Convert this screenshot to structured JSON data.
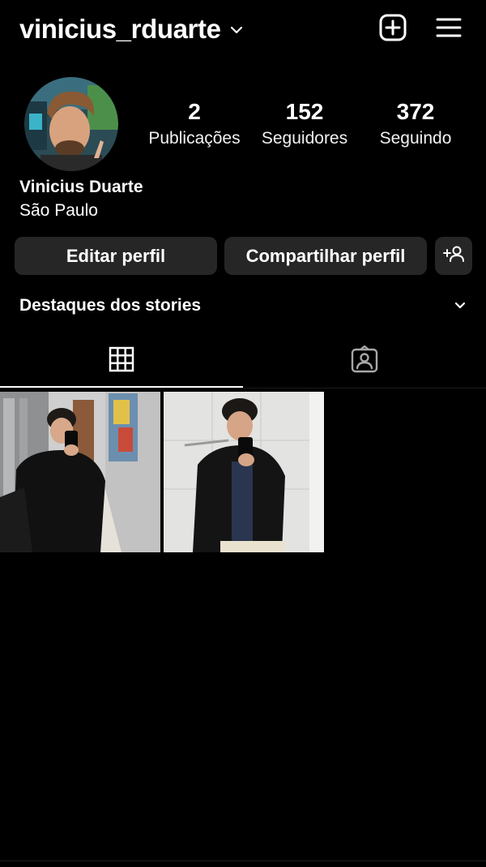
{
  "header": {
    "username": "vinicius_rduarte"
  },
  "profile": {
    "display_name": "Vinicius Duarte",
    "location": "São Paulo",
    "stats": {
      "posts": {
        "value": "2",
        "label": "Publicações"
      },
      "followers": {
        "value": "152",
        "label": "Seguidores"
      },
      "following": {
        "value": "372",
        "label": "Seguindo"
      }
    }
  },
  "buttons": {
    "edit": "Editar perfil",
    "share": "Compartilhar perfil"
  },
  "highlights": {
    "title": "Destaques dos stories"
  },
  "icons": {
    "new_post": "plus-square-icon",
    "menu": "hamburger-menu-icon",
    "username_dropdown": "chevron-down-icon",
    "discover_people": "add-person-icon",
    "highlights_toggle": "chevron-down-icon",
    "grid_tab": "grid-icon",
    "tagged_tab": "tagged-user-icon"
  },
  "colors": {
    "background": "#000000",
    "button_bg": "#262626",
    "text": "#ffffff"
  },
  "tabs": {
    "active": "grid"
  }
}
